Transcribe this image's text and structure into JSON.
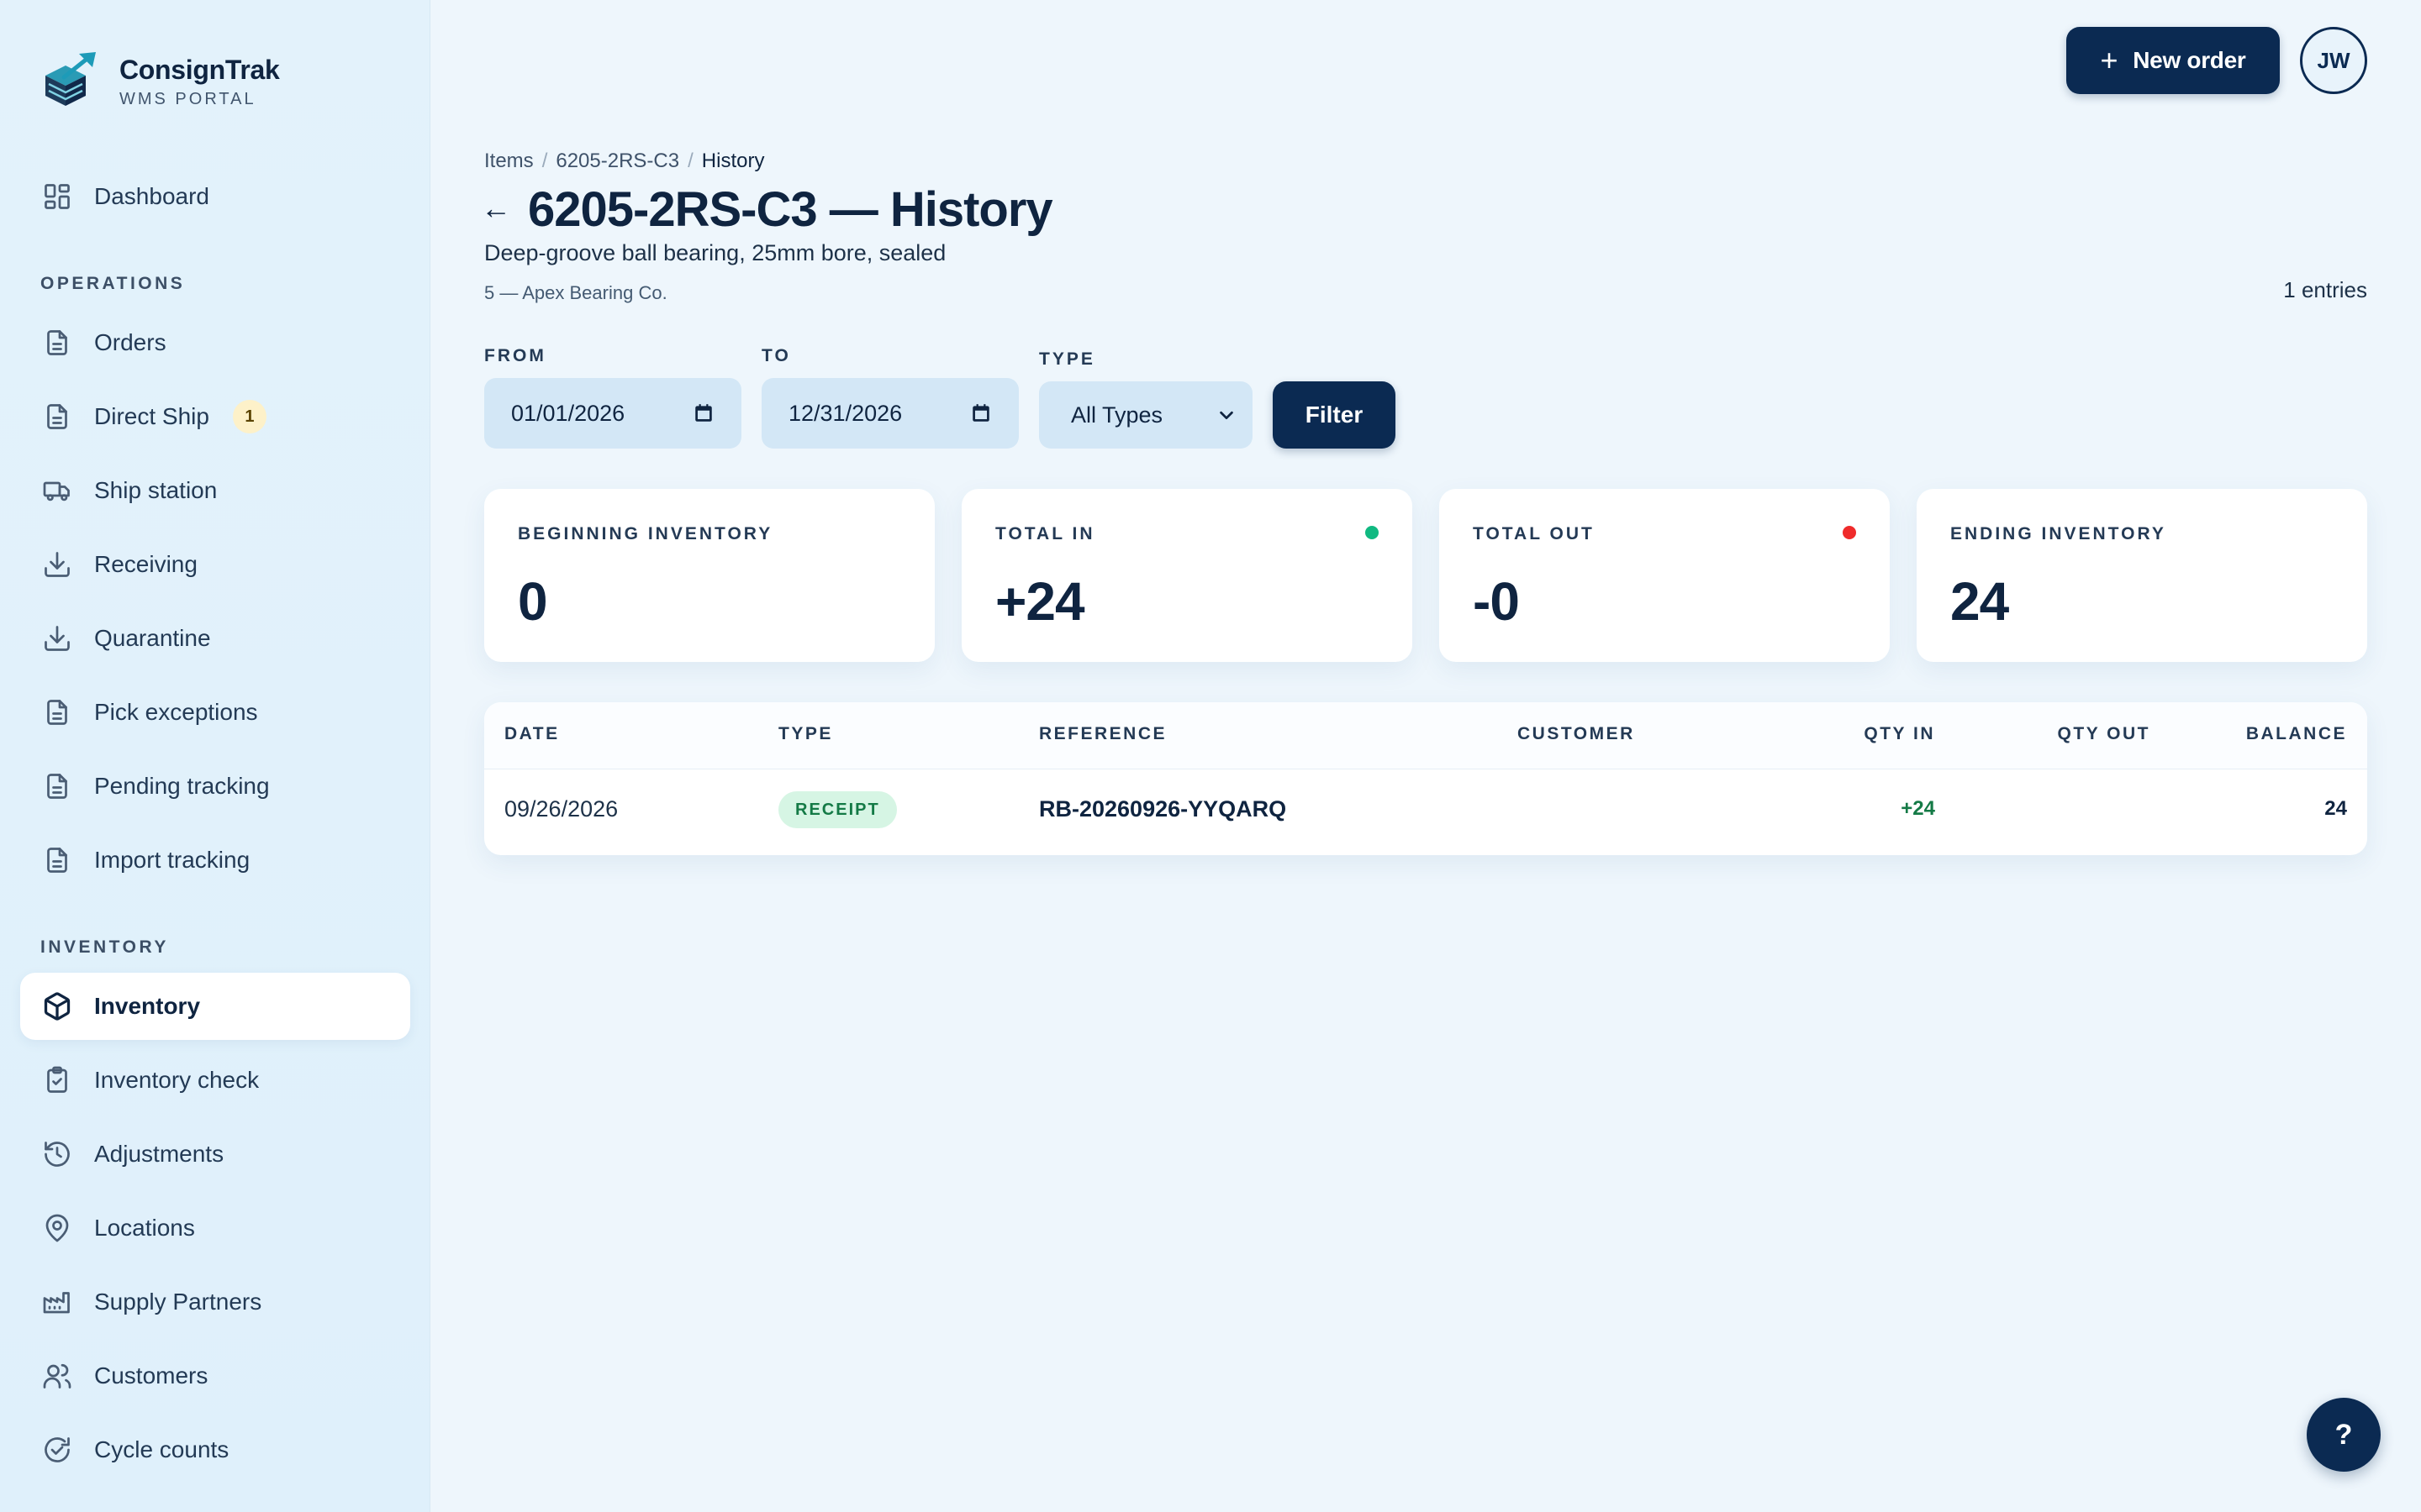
{
  "brand": {
    "name": "ConsignTrak",
    "subtitle": "WMS PORTAL"
  },
  "nav": {
    "dashboard": "Dashboard",
    "sections": {
      "operations": "OPERATIONS",
      "inventory": "INVENTORY"
    },
    "operations": [
      {
        "label": "Orders",
        "icon": "document-icon"
      },
      {
        "label": "Direct Ship",
        "icon": "document-icon",
        "badge": "1"
      },
      {
        "label": "Ship station",
        "icon": "truck-icon"
      },
      {
        "label": "Receiving",
        "icon": "download-icon"
      },
      {
        "label": "Quarantine",
        "icon": "download-icon"
      },
      {
        "label": "Pick exceptions",
        "icon": "document-icon"
      },
      {
        "label": "Pending tracking",
        "icon": "document-icon"
      },
      {
        "label": "Import tracking",
        "icon": "document-icon"
      }
    ],
    "inventory": [
      {
        "label": "Inventory",
        "icon": "box-icon",
        "active": true
      },
      {
        "label": "Inventory check",
        "icon": "clipboard-check-icon"
      },
      {
        "label": "Adjustments",
        "icon": "history-icon"
      },
      {
        "label": "Locations",
        "icon": "map-pin-icon"
      },
      {
        "label": "Supply Partners",
        "icon": "factory-icon"
      },
      {
        "label": "Customers",
        "icon": "users-icon"
      },
      {
        "label": "Cycle counts",
        "icon": "refresh-check-icon"
      }
    ]
  },
  "topbar": {
    "new_order": "New order",
    "avatar": "JW"
  },
  "breadcrumb": {
    "items": "Items",
    "sku": "6205-2RS-C3",
    "current": "History",
    "sep": "/"
  },
  "header": {
    "title": "6205-2RS-C3 — History",
    "description": "Deep-groove ball bearing, 25mm bore, sealed",
    "meta": "5 — Apex Bearing Co.",
    "entries": "1 entries"
  },
  "filters": {
    "from_label": "FROM",
    "from_value": "01/01/2026",
    "to_label": "TO",
    "to_value": "12/31/2026",
    "type_label": "TYPE",
    "type_value": "All Types",
    "filter_button": "Filter"
  },
  "stats": {
    "beginning": {
      "label": "BEGINNING INVENTORY",
      "value": "0"
    },
    "total_in": {
      "label": "TOTAL IN",
      "value": "+24",
      "dot_color": "#10b981"
    },
    "total_out": {
      "label": "TOTAL OUT",
      "value": "-0",
      "dot_color": "#ef2b2b"
    },
    "ending": {
      "label": "ENDING INVENTORY",
      "value": "24"
    }
  },
  "table": {
    "columns": [
      "DATE",
      "TYPE",
      "REFERENCE",
      "CUSTOMER",
      "QTY IN",
      "QTY OUT",
      "BALANCE"
    ],
    "rows": [
      {
        "date": "09/26/2026",
        "type": "RECEIPT",
        "reference": "RB-20260926-YYQARQ",
        "customer": "",
        "qty_in": "+24",
        "qty_out": "",
        "balance": "24"
      }
    ]
  },
  "help": "?",
  "colors": {
    "primary": "#0b2a52",
    "positive": "#147a46",
    "sidebar_bg": "#e3f2fb"
  }
}
